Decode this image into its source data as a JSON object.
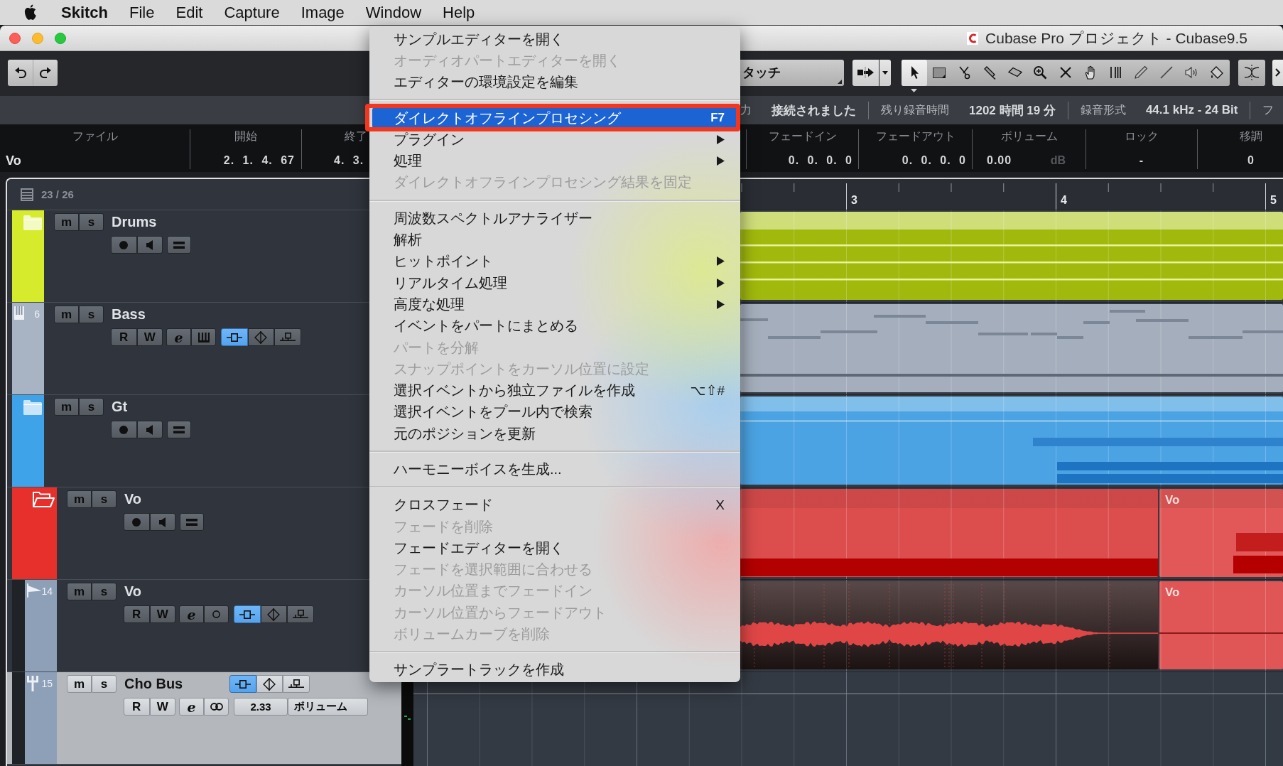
{
  "menubar": {
    "app": "Skitch",
    "menus": [
      "File",
      "Edit",
      "Capture",
      "Image",
      "Window",
      "Help"
    ]
  },
  "window": {
    "title": "Cubase Pro プロジェクト - Cubase9.5"
  },
  "toolbar": {
    "automation_mode": "タッチ",
    "tools": [
      {
        "selected": true
      },
      {
        "selected": false
      },
      {
        "selected": false
      },
      {
        "selected": false
      },
      {
        "selected": false
      },
      {
        "selected": false
      },
      {
        "selected": false
      },
      {
        "selected": false
      },
      {
        "selected": false
      },
      {
        "selected": false
      },
      {
        "selected": false
      },
      {
        "selected": false
      },
      {
        "selected": false
      }
    ]
  },
  "status_line": [
    {
      "label": "力",
      "value": "接続されました"
    },
    {
      "label": "残り録音時間",
      "value": "1202 時間 19 分"
    },
    {
      "label": "録音形式",
      "value": "44.1 kHz - 24 Bit"
    },
    {
      "label": "フ"
    }
  ],
  "info_line": {
    "columns": [
      {
        "header": "ファイル",
        "value": "Vo"
      },
      {
        "header": "開始",
        "value": "2. 1. 4. 67"
      },
      {
        "header": "終了",
        "value": "4. 3."
      },
      {
        "header": "フェードイン",
        "value": "0. 0. 0. 0"
      },
      {
        "header": "フェードアウト",
        "value": "0. 0. 0. 0"
      },
      {
        "header": "ボリューム",
        "value": "0.00",
        "unit": "dB"
      },
      {
        "header": "ロック",
        "value": "-"
      },
      {
        "header": "移調",
        "value": "0"
      }
    ]
  },
  "track_list": {
    "count": "23 / 26",
    "tracks": [
      {
        "name": "Drums",
        "kind": "folder",
        "color": "#d5eb2b",
        "expanded": false,
        "selected": false,
        "mute": {
          "label": "m",
          "on": false
        },
        "solo": {
          "label": "s",
          "on": false
        },
        "events": [
          {
            "color": "#a9c30d",
            "selected": false
          }
        ]
      },
      {
        "name": "Bass",
        "kind": "instrument",
        "number": "6",
        "color": "#a8b3c4",
        "selected": false,
        "mute": {
          "label": "m",
          "on": false
        },
        "solo": {
          "label": "s",
          "on": false
        },
        "read": {
          "label": "R",
          "on": false
        },
        "write": {
          "label": "W",
          "on": false
        },
        "edit": {
          "label": "e"
        },
        "toggles": [
          {
            "on": true
          },
          {
            "on": false
          },
          {
            "on": false
          }
        ],
        "events": [
          {
            "color": "#a5aebc",
            "selected": false
          }
        ]
      },
      {
        "name": "Gt",
        "kind": "folder",
        "color": "#3fa3ea",
        "expanded": false,
        "selected": false,
        "mute": {
          "label": "m",
          "on": false
        },
        "solo": {
          "label": "s",
          "on": false
        },
        "events": [
          {
            "color": "#4ba3e3",
            "selected": false
          }
        ]
      },
      {
        "name": "Vo",
        "kind": "folder",
        "color": "#e7302b",
        "expanded": true,
        "selected": false,
        "mute": {
          "label": "m",
          "on": false
        },
        "solo": {
          "label": "s",
          "on": false
        },
        "events": [
          {
            "color": "#dc4d4d",
            "selected": false
          },
          {
            "label": "Vo",
            "color": "#e25757",
            "selected": false
          }
        ],
        "children": [
          {
            "name": "Vo",
            "kind": "audio",
            "number": "14",
            "color": "#8e9fb8",
            "selected": false,
            "mute": {
              "label": "m",
              "on": false
            },
            "solo": {
              "label": "s",
              "on": false
            },
            "read": {
              "label": "R",
              "on": false
            },
            "write": {
              "label": "W",
              "on": false
            },
            "edit": {
              "label": "e"
            },
            "toggles": [
              {
                "on": true
              },
              {
                "on": false
              },
              {
                "on": false
              }
            ],
            "events": [
              {
                "color": "#e04646",
                "selected": true
              },
              {
                "label": "Vo",
                "color": "#e05656",
                "selected": false
              }
            ]
          },
          {
            "name": "Cho Bus",
            "kind": "group",
            "number": "15",
            "color": "#8e9fb8",
            "selected": true,
            "mute": {
              "label": "m",
              "on": false
            },
            "solo": {
              "label": "s",
              "on": false
            },
            "read": {
              "label": "R",
              "on": false
            },
            "write": {
              "label": "W",
              "on": false
            },
            "edit": {
              "label": "e"
            },
            "toggles": [
              {
                "on": true
              },
              {
                "on": false
              },
              {
                "on": false
              }
            ],
            "value_field": "2.33",
            "parameter_menu": "ボリューム"
          }
        ]
      }
    ]
  },
  "arrangement": {
    "ruler": [
      "3",
      "4",
      "5"
    ]
  },
  "context_menu": {
    "highlight": {
      "kind": "rectangle"
    },
    "groups": [
      [
        {
          "label": "サンプルエディターを開く",
          "disabled": false,
          "selected": false,
          "submenu": false
        },
        {
          "label": "オーディオパートエディターを開く",
          "disabled": true,
          "selected": false,
          "submenu": false
        },
        {
          "label": "エディターの環境設定を編集",
          "disabled": false,
          "selected": false,
          "submenu": false
        }
      ],
      [
        {
          "label": "ダイレクトオフラインプロセシング",
          "shortcut": "F7",
          "disabled": false,
          "selected": true,
          "submenu": false
        },
        {
          "label": "プラグイン",
          "disabled": false,
          "selected": false,
          "submenu": true
        },
        {
          "label": "処理",
          "disabled": false,
          "selected": false,
          "submenu": true
        },
        {
          "label": "ダイレクトオフラインプロセシング結果を固定",
          "disabled": true,
          "selected": false,
          "submenu": false
        }
      ],
      [
        {
          "label": "周波数スペクトルアナライザー",
          "disabled": false,
          "selected": false,
          "submenu": false
        },
        {
          "label": "解析",
          "disabled": false,
          "selected": false,
          "submenu": false
        },
        {
          "label": "ヒットポイント",
          "disabled": false,
          "selected": false,
          "submenu": true
        },
        {
          "label": "リアルタイム処理",
          "disabled": false,
          "selected": false,
          "submenu": true
        },
        {
          "label": "高度な処理",
          "disabled": false,
          "selected": false,
          "submenu": true
        },
        {
          "label": "イベントをパートにまとめる",
          "disabled": false,
          "selected": false,
          "submenu": false
        },
        {
          "label": "パートを分解",
          "disabled": true,
          "selected": false,
          "submenu": false
        },
        {
          "label": "スナップポイントをカーソル位置に設定",
          "disabled": true,
          "selected": false,
          "submenu": false
        },
        {
          "label": "選択イベントから独立ファイルを作成",
          "shortcut": "⌥⇧#",
          "disabled": false,
          "selected": false,
          "submenu": false
        },
        {
          "label": "選択イベントをプール内で検索",
          "disabled": false,
          "selected": false,
          "submenu": false
        },
        {
          "label": "元のポジションを更新",
          "disabled": false,
          "selected": false,
          "submenu": false
        }
      ],
      [
        {
          "label": "ハーモニーボイスを生成...",
          "disabled": false,
          "selected": false,
          "submenu": false
        }
      ],
      [
        {
          "label": "クロスフェード",
          "shortcut": "X",
          "disabled": false,
          "selected": false,
          "submenu": false
        },
        {
          "label": "フェードを削除",
          "disabled": true,
          "selected": false,
          "submenu": false
        },
        {
          "label": "フェードエディターを開く",
          "disabled": false,
          "selected": false,
          "submenu": false
        },
        {
          "label": "フェードを選択範囲に合わせる",
          "disabled": true,
          "selected": false,
          "submenu": false
        },
        {
          "label": "カーソル位置までフェードイン",
          "disabled": true,
          "selected": false,
          "submenu": false
        },
        {
          "label": "カーソル位置からフェードアウト",
          "disabled": true,
          "selected": false,
          "submenu": false
        },
        {
          "label": "ボリュームカーブを削除",
          "disabled": true,
          "selected": false,
          "submenu": false
        }
      ],
      [
        {
          "label": "サンプラートラックを作成",
          "disabled": false,
          "selected": false,
          "submenu": false
        }
      ]
    ]
  }
}
